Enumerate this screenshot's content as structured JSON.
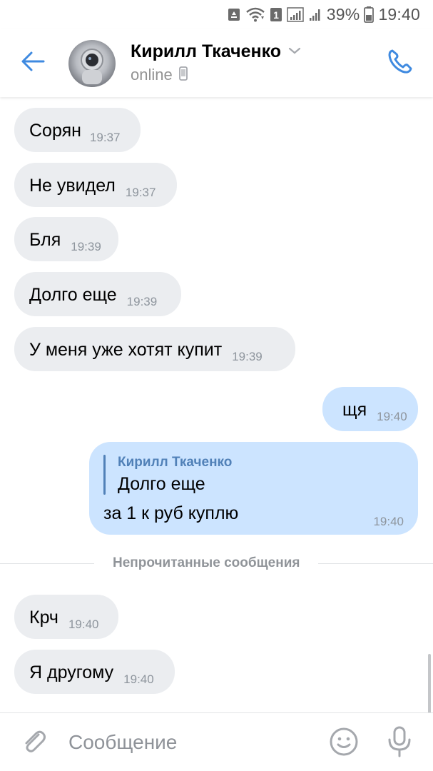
{
  "status_bar": {
    "battery_percent": "39%",
    "time": "19:40",
    "sim_badge": "1"
  },
  "header": {
    "contact_name": "Кирилл Ткаченко",
    "status": "online",
    "icons": {
      "back": "arrow-left-icon",
      "call": "phone-icon",
      "dropdown": "chevron-down-icon",
      "device": "mobile-device-icon"
    },
    "accent_color": "#3f8ae0"
  },
  "messages": [
    {
      "direction": "in",
      "text": "Сорян",
      "time": "19:37"
    },
    {
      "direction": "in",
      "text": "Не увидел",
      "time": "19:37"
    },
    {
      "direction": "in",
      "text": "Бля",
      "time": "19:39"
    },
    {
      "direction": "in",
      "text": "Долго еще",
      "time": "19:39"
    },
    {
      "direction": "in",
      "text": "У меня уже хотят купит",
      "time": "19:39"
    },
    {
      "direction": "out",
      "text": "щя",
      "time": "19:40"
    }
  ],
  "reply_message": {
    "quoted_author": "Кирилл Ткаченко",
    "quoted_text": "Долго еще",
    "text": "за 1 к руб куплю",
    "time": "19:40"
  },
  "unread_divider": "Непрочитанные сообщения",
  "unread_messages": [
    {
      "direction": "in",
      "text": "Крч",
      "time": "19:40"
    },
    {
      "direction": "in",
      "text": "Я другому",
      "time": "19:40"
    }
  ],
  "composer": {
    "placeholder": "Сообщение",
    "value": "",
    "icons": {
      "attach": "paperclip-icon",
      "emoji": "smiley-icon",
      "voice": "microphone-icon"
    }
  },
  "colors": {
    "incoming_bubble": "#ebedf0",
    "outgoing_bubble": "#cce4ff",
    "time_text": "#8e959d",
    "reply_author": "#5181b8"
  }
}
